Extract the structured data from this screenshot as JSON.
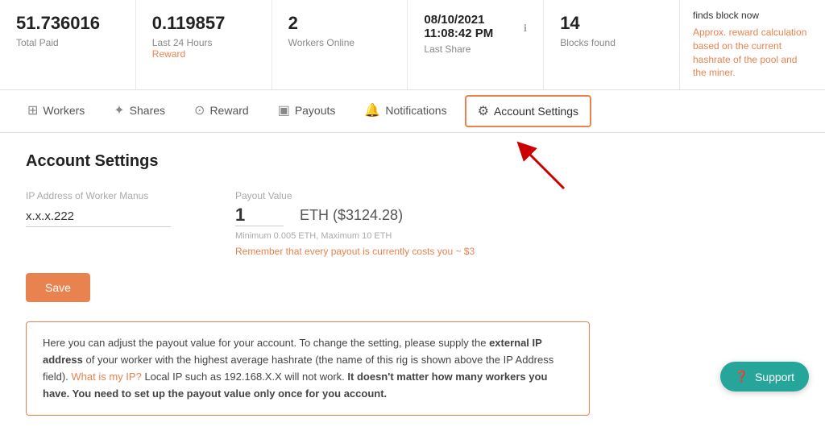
{
  "stats": [
    {
      "id": "total-paid",
      "value": "51.736016",
      "label": "Total Paid",
      "sublabel": null
    },
    {
      "id": "last-24h",
      "value": "0.119857",
      "label": "Last 24 Hours",
      "sublabel": "Reward"
    },
    {
      "id": "workers",
      "value": "2",
      "label": "Workers Online",
      "sublabel": null
    },
    {
      "id": "last-share",
      "value": "08/10/2021 11:08:42 PM",
      "label": "Last Share",
      "sublabel": null
    },
    {
      "id": "blocks-found",
      "value": "14",
      "label": "Blocks found",
      "sublabel": null
    }
  ],
  "approx_card": {
    "finds_text": "finds block now",
    "desc_text": "Approx. reward calculation based on the current hashrate of the pool and the miner."
  },
  "nav": {
    "tabs": [
      {
        "id": "workers",
        "label": "Workers",
        "icon": "⊞"
      },
      {
        "id": "shares",
        "label": "Shares",
        "icon": "⤢"
      },
      {
        "id": "reward",
        "label": "Reward",
        "icon": "⊙"
      },
      {
        "id": "payouts",
        "label": "Payouts",
        "icon": "▣"
      },
      {
        "id": "notifications",
        "label": "Notifications",
        "icon": "🔔"
      },
      {
        "id": "account-settings",
        "label": "Account Settings",
        "icon": "⚙"
      }
    ],
    "active_tab": "account-settings"
  },
  "account_settings": {
    "title": "Account Settings",
    "ip_label": "IP Address of Worker Manus",
    "ip_value": "x.x.x.222",
    "payout_label": "Payout Value",
    "payout_value": "1",
    "eth_value": "ETH ($3124.28)",
    "payout_min": "Minimum 0.005 ETH, Maximum 10 ETH",
    "payout_warning": "Remember that every payout is currently costs you ~ $3",
    "save_label": "Save"
  },
  "info_box": {
    "text_before_bold": "Here you can adjust the payout value for your account. To change the setting, please supply the ",
    "bold1": "external IP address",
    "text_after_bold1": " of your worker with the highest average hashrate (the name of this rig is shown above the IP Address field). ",
    "orange_link": "What is my IP?",
    "text_after_link": " Local IP such as 192.168.X.X will not work. ",
    "bold2": "It doesn't matter how many workers you have. You need to set up the payout value only once for you account."
  },
  "support": {
    "label": "Support",
    "icon": "❓"
  }
}
